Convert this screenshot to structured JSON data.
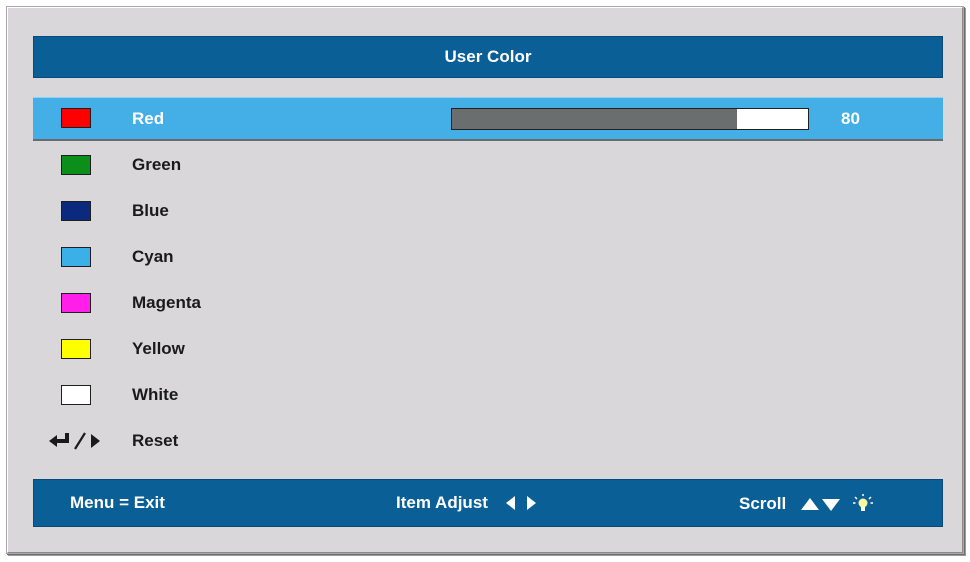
{
  "menu": {
    "title": "User Color",
    "items": [
      {
        "label": "Red",
        "swatch_color": "#ff0000",
        "value": "80",
        "level_percent": 80,
        "selected": true
      },
      {
        "label": "Green",
        "swatch_color": "#0b8f1a"
      },
      {
        "label": "Blue",
        "swatch_color": "#0b2a7e"
      },
      {
        "label": "Cyan",
        "swatch_color": "#3bb0e8"
      },
      {
        "label": "Magenta",
        "swatch_color": "#ff1fe9"
      },
      {
        "label": "Yellow",
        "swatch_color": "#ffff00"
      },
      {
        "label": "White",
        "swatch_color": "#ffffff"
      }
    ],
    "reset": {
      "label": "Reset",
      "icon": "enter-right-arrow-icon"
    }
  },
  "footer": {
    "exit_label": "Menu = Exit",
    "adjust_label": "Item Adjust",
    "adjust_icon": "left-right-arrows-icon",
    "scroll_label": "Scroll",
    "scroll_icon": "up-down-arrows-icon",
    "extra_icon": "lightbulb-icon"
  },
  "colors": {
    "header_bg": "#0a5f96",
    "selected_row_bg": "#44aee6",
    "panel_bg": "#d9d7da",
    "slider_fill": "#6b6e6e"
  }
}
